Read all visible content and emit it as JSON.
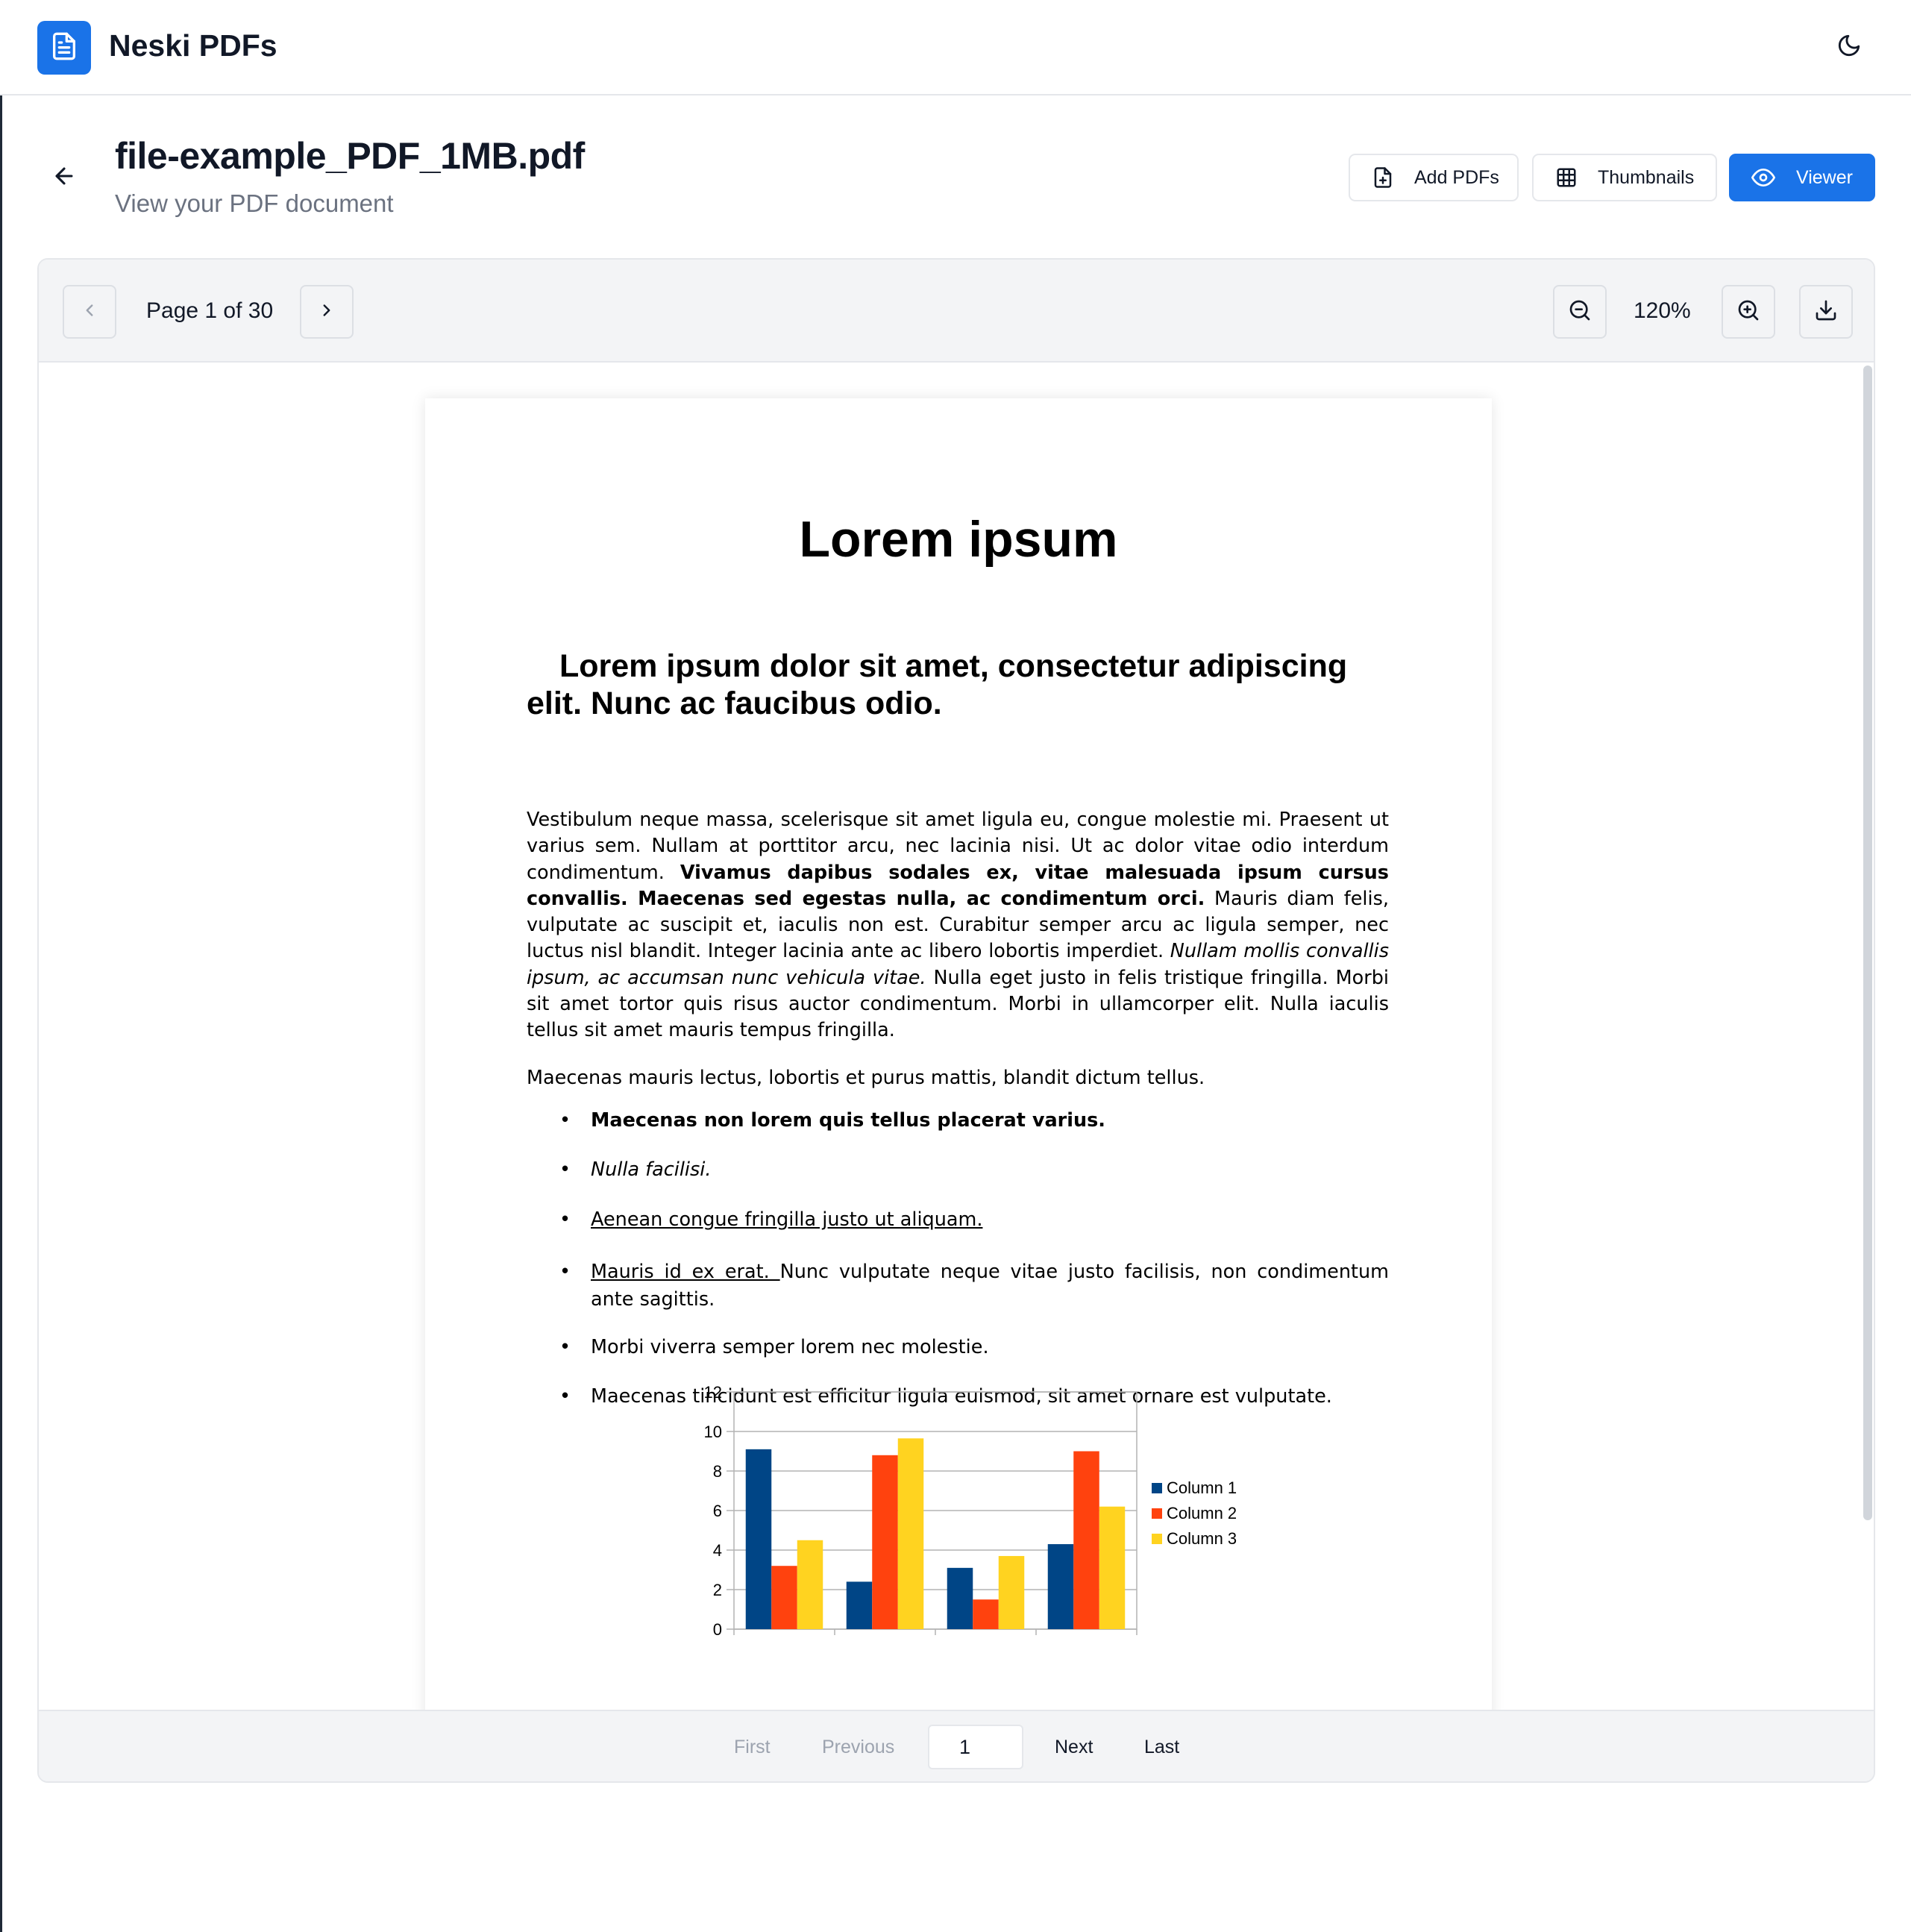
{
  "app": {
    "title": "Neski PDFs",
    "logo_icon": "document-icon",
    "theme_icon": "moon-icon"
  },
  "header": {
    "back_icon": "arrow-left-icon",
    "title": "file-example_PDF_1MB.pdf",
    "subtitle": "View your PDF document",
    "buttons": [
      {
        "label": "Add PDFs",
        "icon": "file-plus-icon"
      },
      {
        "label": "Thumbnails",
        "icon": "grid-icon"
      },
      {
        "label": "Viewer",
        "icon": "eye-icon",
        "active": true
      }
    ]
  },
  "toolbar": {
    "page_indicator": "Page 1 of 30",
    "zoom_level": "120%",
    "prev_icon": "chevron-left-icon",
    "next_icon": "chevron-right-icon",
    "zoom_out_icon": "zoom-out-icon",
    "zoom_in_icon": "zoom-in-icon",
    "download_icon": "download-icon"
  },
  "document": {
    "heading": "Lorem ipsum",
    "subheading": "Lorem ipsum dolor sit amet, consectetur adipiscing elit. Nunc ac faucibus odio.",
    "para1": {
      "s1": "Vestibulum neque massa, scelerisque sit amet ligula eu, congue molestie mi. Praesent ut varius sem. Nullam at porttitor arcu, nec lacinia nisi. Ut ac dolor vitae odio interdum condimentum. ",
      "bold": "Vivamus dapibus sodales ex, vitae malesuada ipsum cursus convallis. Maecenas sed egestas nulla, ac condimentum orci.",
      "s2": " Mauris diam felis, vulputate ac suscipit et, iaculis non est. Curabitur semper arcu ac ligula semper, nec luctus nisl blandit. Integer lacinia ante ac libero lobortis imperdiet. ",
      "italic": "Nullam mollis convallis ipsum, ac accumsan nunc vehicula vitae.",
      "s3": " Nulla eget justo in felis tristique fringilla. Morbi sit amet tortor quis risus auctor condimentum. Morbi in ullamcorper elit. Nulla iaculis tellus sit amet mauris tempus fringilla."
    },
    "para2": "Maecenas mauris lectus, lobortis et purus mattis, blandit dictum tellus.",
    "list": [
      "Maecenas non lorem quis tellus placerat varius.",
      "Nulla facilisi.",
      "Aenean congue fringilla justo ut aliquam. ",
      {
        "underlined": "Mauris id ex erat. ",
        "rest": "Nunc vulputate neque vitae justo facilisis, non condimentum ante sagittis."
      },
      "Morbi viverra semper lorem nec molestie.",
      "Maecenas tincidunt est efficitur ligula euismod, sit amet ornare est vulputate."
    ],
    "bullet": "•"
  },
  "chart_data": {
    "type": "bar",
    "categories": [
      "",
      "",
      "",
      ""
    ],
    "series": [
      {
        "name": "Column 1",
        "values": [
          9.1,
          2.4,
          3.1,
          4.3
        ],
        "color": "#004586"
      },
      {
        "name": "Column 2",
        "values": [
          3.2,
          8.8,
          1.5,
          9.0
        ],
        "color": "#ff420e"
      },
      {
        "name": "Column 3",
        "values": [
          4.5,
          9.65,
          3.7,
          6.2
        ],
        "color": "#ffd320"
      }
    ],
    "ylim": [
      0,
      12
    ],
    "yticks": [
      "0",
      "2",
      "4",
      "6",
      "8",
      "10",
      "12"
    ],
    "grid": true,
    "legend": "right"
  },
  "pager": {
    "first": "First",
    "previous": "Previous",
    "page_value": "1",
    "next": "Next",
    "last": "Last"
  },
  "colors": {
    "accent": "#1a73e8"
  }
}
